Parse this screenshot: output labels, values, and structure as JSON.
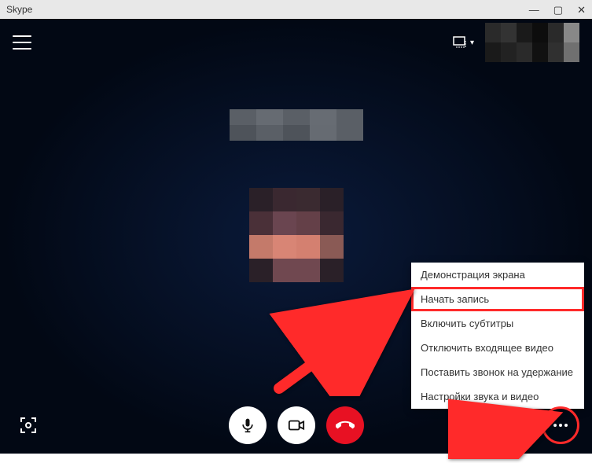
{
  "window": {
    "title": "Skype"
  },
  "menu": {
    "items": [
      {
        "label": "Демонстрация экрана"
      },
      {
        "label": "Начать запись",
        "highlighted": true
      },
      {
        "label": "Включить субтитры"
      },
      {
        "label": "Отключить входящее видео"
      },
      {
        "label": "Поставить звонок на удержание"
      },
      {
        "label": "Настройки звука и видео"
      }
    ]
  },
  "icons": {
    "hamburger": "menu-icon",
    "resize": "resize-icon",
    "fullscreen": "fullscreen-icon",
    "mic": "microphone-icon",
    "video": "video-icon",
    "hangup": "hangup-icon",
    "chat": "chat-icon",
    "heart": "reaction-icon",
    "more": "more-icon"
  }
}
